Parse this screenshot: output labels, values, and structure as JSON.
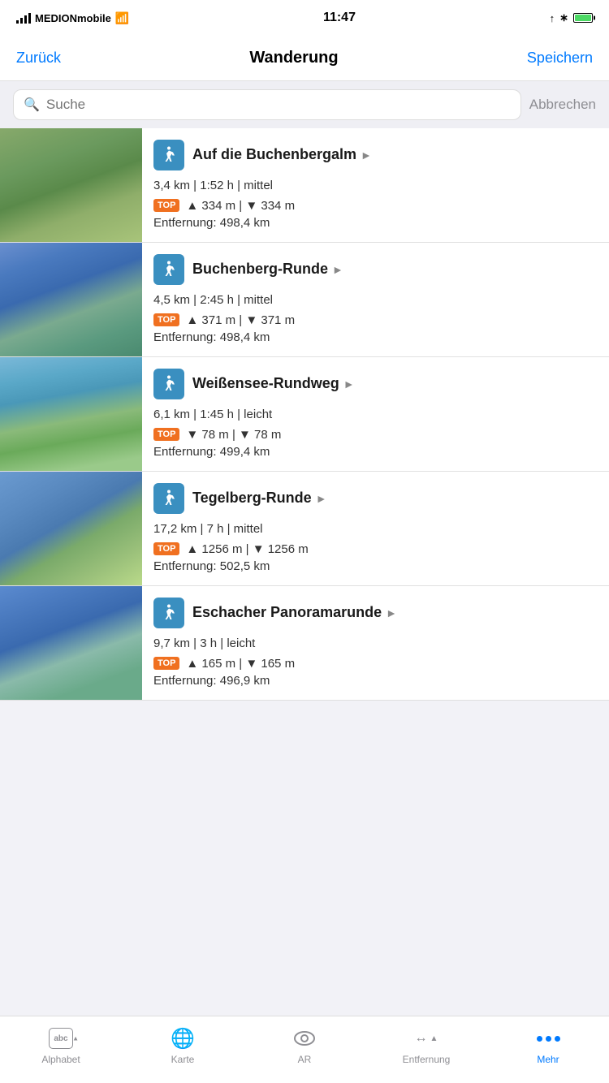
{
  "statusBar": {
    "carrier": "MEDIONmobile",
    "time": "11:47"
  },
  "navBar": {
    "back": "Zurück",
    "title": "Wanderung",
    "save": "Speichern"
  },
  "search": {
    "placeholder": "Suche",
    "cancel": "Abbrechen"
  },
  "items": [
    {
      "id": 1,
      "title": "Auf die Buchenbergalm",
      "stats": "3,4 km | 1:52 h | mittel",
      "elevation": "▲ 334 m | ▼ 334 m",
      "distance": "Entfernung: 498,4 km",
      "hasTop": true,
      "thumbClass": "thumb-1"
    },
    {
      "id": 2,
      "title": "Buchenberg-Runde",
      "stats": "4,5 km | 2:45 h | mittel",
      "elevation": "▲ 371 m | ▼ 371 m",
      "distance": "Entfernung: 498,4 km",
      "hasTop": true,
      "thumbClass": "thumb-2"
    },
    {
      "id": 3,
      "title": "Weißensee-Rundweg",
      "stats": "6,1 km | 1:45 h | leicht",
      "elevation": "▼ 78 m | ▼ 78 m",
      "distance": "Entfernung: 499,4 km",
      "hasTop": true,
      "thumbClass": "thumb-3"
    },
    {
      "id": 4,
      "title": "Tegelberg-Runde",
      "stats": "17,2 km | 7 h | mittel",
      "elevation": "▲ 1256 m | ▼ 1256 m",
      "distance": "Entfernung: 502,5 km",
      "hasTop": true,
      "thumbClass": "thumb-4"
    },
    {
      "id": 5,
      "title": "Eschacher Panoramarunde",
      "stats": "9,7 km | 3 h | leicht",
      "elevation": "▲ 165 m | ▼ 165 m",
      "distance": "Entfernung: 496,9 km",
      "hasTop": true,
      "thumbClass": "thumb-5"
    }
  ],
  "tabBar": {
    "items": [
      {
        "id": "alphabet",
        "label": "Alphabet",
        "icon": "abc-icon",
        "active": false
      },
      {
        "id": "karte",
        "label": "Karte",
        "icon": "globe-icon",
        "active": false
      },
      {
        "id": "ar",
        "label": "AR",
        "icon": "eye-icon",
        "active": false
      },
      {
        "id": "entfernung",
        "label": "Entfernung",
        "icon": "dist-icon",
        "active": false
      },
      {
        "id": "mehr",
        "label": "Mehr",
        "icon": "more-icon",
        "active": true
      }
    ]
  },
  "topBadge": "TOP"
}
